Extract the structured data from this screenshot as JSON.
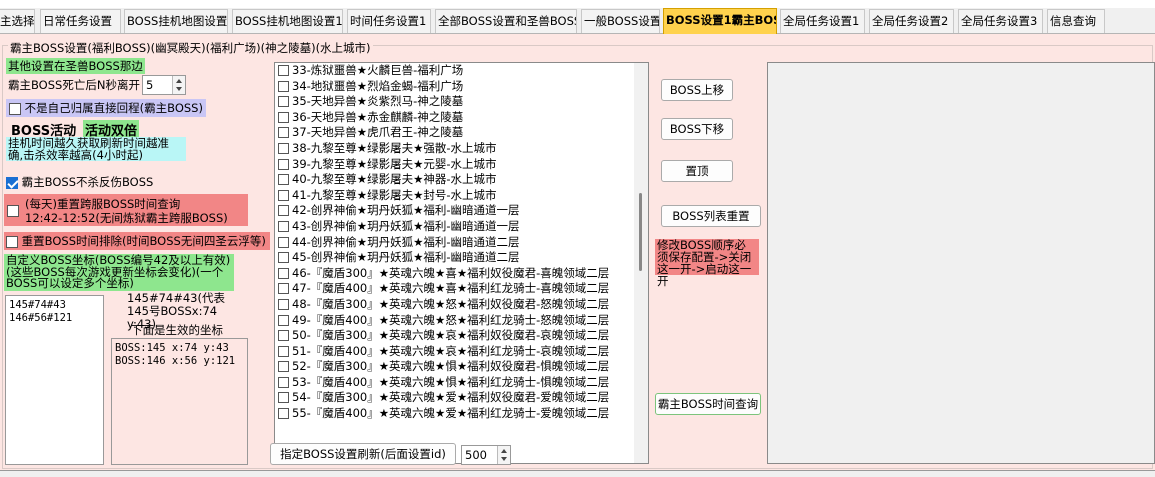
{
  "tabs": [
    {
      "label": "主选择",
      "active": false
    },
    {
      "label": "日常任务设置",
      "active": false
    },
    {
      "label": "BOSS挂机地图设置",
      "active": false
    },
    {
      "label": "BOSS挂机地图设置1",
      "active": false
    },
    {
      "label": "时间任务设置1",
      "active": false
    },
    {
      "label": "全部BOSS设置和圣兽BOSS",
      "active": false
    },
    {
      "label": "一般BOSS设置",
      "active": false
    },
    {
      "label": "BOSS设置1霸主BOSS",
      "active": true
    },
    {
      "label": "全局任务设置1",
      "active": false
    },
    {
      "label": "全局任务设置2",
      "active": false
    },
    {
      "label": "全局任务设置3",
      "active": false
    },
    {
      "label": "信息查询",
      "active": false
    }
  ],
  "group_title": "霸主BOSS设置(福利BOSS)(幽冥殿天)(福利广场)(神之陵墓)(水上城市)",
  "left": {
    "other_settings_note": "其他设置在圣兽BOSS那边",
    "leave_after_death_label": "霸主BOSS死亡后N秒离开",
    "leave_after_death_value": "5",
    "return_checkbox_label": "不是自己归属直接回程(霸主BOSS)",
    "boss_activity_label": "BOSS活动",
    "activity_double_label": "活动双倍",
    "hang_time_note": "挂机时间越久获取刷新时间越准确,击杀效率越高(4小时起)",
    "no_kill_label": "霸主BOSS不杀反伤BOSS",
    "reset_query_label": "(每天)重置跨服BOSS时间查询",
    "reset_query_time": "12:42-12:52(无间炼狱霸主跨服BOSS)",
    "reset_exclude_label": "重置BOSS时间排除(时间BOSS无间四圣云浮等)",
    "custom_coords_note": "自定义BOSS坐标(BOSS编号42及以上有效)(这些BOSS每次游戏更新坐标会变化)(一个BOSS可以设定多个坐标)",
    "coords_input": "145#74#43\n146#56#121",
    "coords_example": "145#74#43(代表145号BOSSx:74 y:43)",
    "effective_label": "下面是生效的坐标",
    "effective_coords": "BOSS:145 x:74 y:43\nBOSS:146 x:56 y:121"
  },
  "boss_list": [
    "33-炼狱噩兽★火麟巨兽-福利广场",
    "34-地狱噩兽★烈焰金蝎-福利广场",
    "35-天地异兽★炎紫烈马-神之陵墓",
    "36-天地异兽★赤金麒麟-神之陵墓",
    "37-天地异兽★虎爪君王-神之陵墓",
    "38-九黎至尊★绿影屠夫★强散-水上城市",
    "39-九黎至尊★绿影屠夫★元婴-水上城市",
    "40-九黎至尊★绿影屠夫★神器-水上城市",
    "41-九黎至尊★绿影屠夫★封号-水上城市",
    "42-创界神偷★玥丹妖狐★福利-幽暗通道一层",
    "43-创界神偷★玥丹妖狐★福利-幽暗通道一层",
    "44-创界神偷★玥丹妖狐★福利-幽暗通道二层",
    "45-创界神偷★玥丹妖狐★福利-幽暗通道二层",
    "46-『魔盾300』★英魂六魄★喜★福利奴役魔君-喜魄领域二层",
    "47-『魔盾400』★英魂六魄★喜★福利红龙骑士-喜魄领域二层",
    "48-『魔盾300』★英魂六魄★怒★福利奴役魔君-怒魄领域二层",
    "49-『魔盾400』★英魂六魄★怒★福利红龙骑士-怒魄领域二层",
    "50-『魔盾300』★英魂六魄★哀★福利奴役魔君-哀魄领域二层",
    "51-『魔盾400』★英魂六魄★哀★福利红龙骑士-哀魄领域二层",
    "52-『魔盾300』★英魂六魄★惧★福利奴役魔君-惧魄领域二层",
    "53-『魔盾400』★英魂六魄★惧★福利红龙骑士-惧魄领域二层",
    "54-『魔盾300』★英魂六魄★爱★福利奴役魔君-爱魄领域二层",
    "55-『魔盾400』★英魂六魄★爱★福利红龙骑士-爱魄领域二层"
  ],
  "buttons": {
    "move_up": "BOSS上移",
    "move_down": "BOSS下移",
    "top": "置顶",
    "reset_list": "BOSS列表重置",
    "time_query": "霸主BOSS时间查询",
    "refresh": "指定BOSS设置刷新(后面设置id)"
  },
  "order_warning": "修改BOSS顺序必须保存配置->关闭这一开->启动这一开",
  "refresh_id_value": "500",
  "colors": {
    "tab_active": "#ffd24d",
    "panel_bg": "#fde6e3",
    "note_green": "#8ee68e",
    "warn_red": "#f28686",
    "note_cyan": "#b9f6f6",
    "note_purple": "#c9c6f5"
  }
}
